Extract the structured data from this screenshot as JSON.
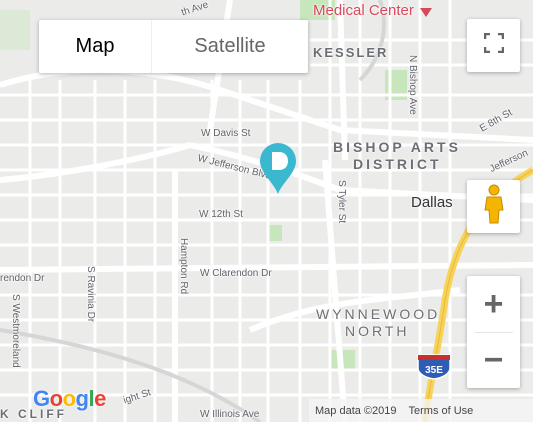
{
  "map_type": {
    "map_label": "Map",
    "satellite_label": "Satellite",
    "selected": "Map"
  },
  "districts": {
    "bishop_arts_line1": "BISHOP ARTS",
    "bishop_arts_line2": "DISTRICT",
    "wynnewood_line1": "WYNNEWOOD",
    "wynnewood_line2": "NORTH",
    "kessler": "KESSLER"
  },
  "poi": {
    "medical_center": "Medical Center"
  },
  "city": {
    "dallas": "Dallas"
  },
  "streets": {
    "w_davis": "W Davis St",
    "w_jefferson": "W Jefferson Blvd",
    "w_12th": "W 12th St",
    "w_clarendon": "W Clarendon Dr",
    "w_clarendon_left": "rendon Dr",
    "s_tyler": "S Tyler St",
    "n_bishop": "N Bishop Ave",
    "e_8th": "E 8th St",
    "jefferson_right": "Jefferson",
    "hampton": "Hampton Rd",
    "s_ravinia": "S Ravinia Dr",
    "s_westmoreland": "S Westmoreland",
    "w_illinois": "W Illinois Ave",
    "light_st": "ight St",
    "th_ave": "th Ave",
    "bottom_left": "K CLIFF"
  },
  "highway": {
    "shield": "35E"
  },
  "controls": {
    "fullscreen_icon": "fullscreen-icon",
    "pegman_icon": "pegman-icon",
    "zoom_in": "+",
    "zoom_out": "−"
  },
  "attribution": {
    "logo": "Google",
    "map_data": "Map data ©2019",
    "terms": "Terms of Use"
  },
  "colors": {
    "pin": "#3ab8d0",
    "highway": "#f7d35a",
    "park": "#c7e6bc",
    "water": "#aadaff",
    "poi": "#d9485b"
  }
}
